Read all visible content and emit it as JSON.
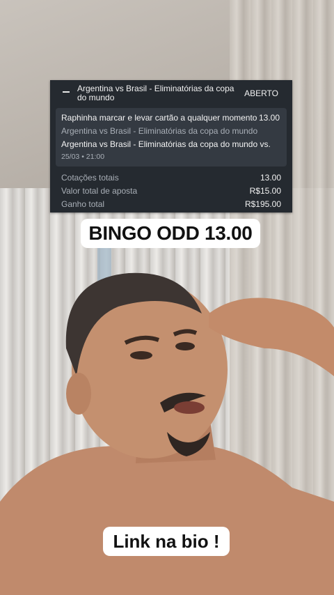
{
  "bet_slip": {
    "match_title": "Argentina vs Brasil - Eliminatórias da copa do mundo",
    "status": "ABERTO",
    "selection": {
      "market": "Raphinha marcar e levar cartão a qualquer momento",
      "odd": "13.00",
      "event": "Argentina vs Brasil - Eliminatórias da copa do mundo",
      "event_full": "Argentina vs Brasil - Eliminatórias da copa do mundo vs.",
      "datetime": "25/03 • 21:00"
    },
    "summary": [
      {
        "label": "Cotações totais",
        "value": "13.00"
      },
      {
        "label": "Valor total de aposta",
        "value": "R$15.00"
      },
      {
        "label": "Ganho total",
        "value": "R$195.00"
      }
    ]
  },
  "captions": {
    "top": "BINGO ODD 13.00",
    "bottom": "Link na bio !"
  },
  "colors": {
    "card_bg": "#252a30",
    "selection_bg": "#343a42",
    "muted_text": "#a9afb7"
  }
}
